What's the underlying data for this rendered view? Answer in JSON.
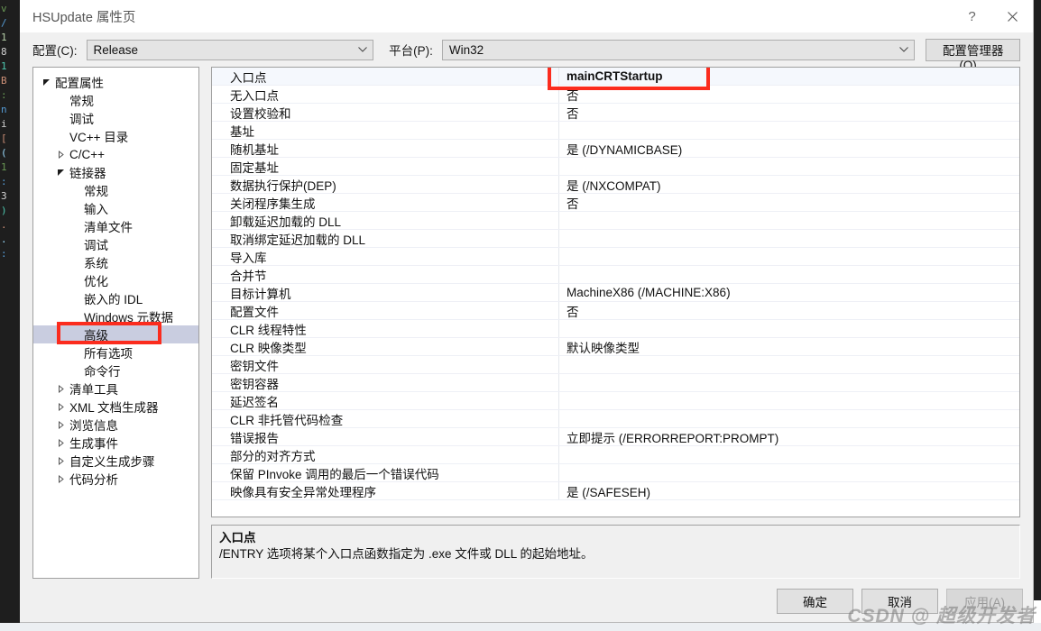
{
  "window": {
    "title": "HSUpdate 属性页",
    "help_icon": "question-mark-icon",
    "close_icon": "close-icon"
  },
  "config_bar": {
    "config_label": "配置(C):",
    "config_value": "Release",
    "platform_label": "平台(P):",
    "platform_value": "Win32",
    "config_manager_button": "配置管理器(O)..."
  },
  "tree": [
    {
      "label": "配置属性",
      "indent": 0,
      "arrow": "expanded",
      "selected": false
    },
    {
      "label": "常规",
      "indent": 1,
      "arrow": "none",
      "selected": false
    },
    {
      "label": "调试",
      "indent": 1,
      "arrow": "none",
      "selected": false
    },
    {
      "label": "VC++ 目录",
      "indent": 1,
      "arrow": "none",
      "selected": false
    },
    {
      "label": "C/C++",
      "indent": 1,
      "arrow": "collapsed",
      "selected": false
    },
    {
      "label": "链接器",
      "indent": 1,
      "arrow": "expanded",
      "selected": false
    },
    {
      "label": "常规",
      "indent": 2,
      "arrow": "none",
      "selected": false
    },
    {
      "label": "输入",
      "indent": 2,
      "arrow": "none",
      "selected": false
    },
    {
      "label": "清单文件",
      "indent": 2,
      "arrow": "none",
      "selected": false
    },
    {
      "label": "调试",
      "indent": 2,
      "arrow": "none",
      "selected": false
    },
    {
      "label": "系统",
      "indent": 2,
      "arrow": "none",
      "selected": false
    },
    {
      "label": "优化",
      "indent": 2,
      "arrow": "none",
      "selected": false
    },
    {
      "label": "嵌入的 IDL",
      "indent": 2,
      "arrow": "none",
      "selected": false
    },
    {
      "label": "Windows 元数据",
      "indent": 2,
      "arrow": "none",
      "selected": false
    },
    {
      "label": "高级",
      "indent": 2,
      "arrow": "none",
      "selected": true
    },
    {
      "label": "所有选项",
      "indent": 2,
      "arrow": "none",
      "selected": false
    },
    {
      "label": "命令行",
      "indent": 2,
      "arrow": "none",
      "selected": false
    },
    {
      "label": "清单工具",
      "indent": 1,
      "arrow": "collapsed",
      "selected": false
    },
    {
      "label": "XML 文档生成器",
      "indent": 1,
      "arrow": "collapsed",
      "selected": false
    },
    {
      "label": "浏览信息",
      "indent": 1,
      "arrow": "collapsed",
      "selected": false
    },
    {
      "label": "生成事件",
      "indent": 1,
      "arrow": "collapsed",
      "selected": false
    },
    {
      "label": "自定义生成步骤",
      "indent": 1,
      "arrow": "collapsed",
      "selected": false
    },
    {
      "label": "代码分析",
      "indent": 1,
      "arrow": "collapsed",
      "selected": false
    }
  ],
  "grid": {
    "rows": [
      {
        "name": "入口点",
        "value": "mainCRTStartup",
        "selected": true,
        "bold": true
      },
      {
        "name": "无入口点",
        "value": "否",
        "selected": false,
        "bold": false
      },
      {
        "name": "设置校验和",
        "value": "否",
        "selected": false,
        "bold": false
      },
      {
        "name": "基址",
        "value": "",
        "selected": false,
        "bold": false
      },
      {
        "name": "随机基址",
        "value": "是 (/DYNAMICBASE)",
        "selected": false,
        "bold": false
      },
      {
        "name": "固定基址",
        "value": "",
        "selected": false,
        "bold": false
      },
      {
        "name": "数据执行保护(DEP)",
        "value": "是 (/NXCOMPAT)",
        "selected": false,
        "bold": false
      },
      {
        "name": "关闭程序集生成",
        "value": "否",
        "selected": false,
        "bold": false
      },
      {
        "name": "卸载延迟加载的 DLL",
        "value": "",
        "selected": false,
        "bold": false
      },
      {
        "name": "取消绑定延迟加载的 DLL",
        "value": "",
        "selected": false,
        "bold": false
      },
      {
        "name": "导入库",
        "value": "",
        "selected": false,
        "bold": false
      },
      {
        "name": "合并节",
        "value": "",
        "selected": false,
        "bold": false
      },
      {
        "name": "目标计算机",
        "value": "MachineX86 (/MACHINE:X86)",
        "selected": false,
        "bold": false
      },
      {
        "name": "配置文件",
        "value": "否",
        "selected": false,
        "bold": false
      },
      {
        "name": "CLR 线程特性",
        "value": "",
        "selected": false,
        "bold": false
      },
      {
        "name": "CLR 映像类型",
        "value": "默认映像类型",
        "selected": false,
        "bold": false
      },
      {
        "name": "密钥文件",
        "value": "",
        "selected": false,
        "bold": false
      },
      {
        "name": "密钥容器",
        "value": "",
        "selected": false,
        "bold": false
      },
      {
        "name": "延迟签名",
        "value": "",
        "selected": false,
        "bold": false
      },
      {
        "name": "CLR 非托管代码检查",
        "value": "",
        "selected": false,
        "bold": false
      },
      {
        "name": "错误报告",
        "value": "立即提示 (/ERRORREPORT:PROMPT)",
        "selected": false,
        "bold": false
      },
      {
        "name": "部分的对齐方式",
        "value": "",
        "selected": false,
        "bold": false
      },
      {
        "name": "保留 PInvoke 调用的最后一个错误代码",
        "value": "",
        "selected": false,
        "bold": false
      },
      {
        "name": "映像具有安全异常处理程序",
        "value": "是 (/SAFESEH)",
        "selected": false,
        "bold": false
      }
    ]
  },
  "description": {
    "title": "入口点",
    "text": "/ENTRY 选项将某个入口点函数指定为 .exe 文件或 DLL 的起始地址。"
  },
  "footer": {
    "ok": "确定",
    "cancel": "取消",
    "apply": "应用(A)"
  },
  "annotations": {
    "accent_color": "#fb2c1e",
    "highlight_color": "#c9cde0"
  },
  "watermark": "CSDN @ 超级开发者",
  "background_code_lines": [
    "v",
    "/",
    "1",
    "8",
    "1",
    "B",
    "",
    ":",
    "n",
    "",
    "i",
    "",
    "[",
    "(",
    "1",
    ":",
    "",
    "3",
    ")",
    ".",
    ".",
    "",
    ":"
  ]
}
